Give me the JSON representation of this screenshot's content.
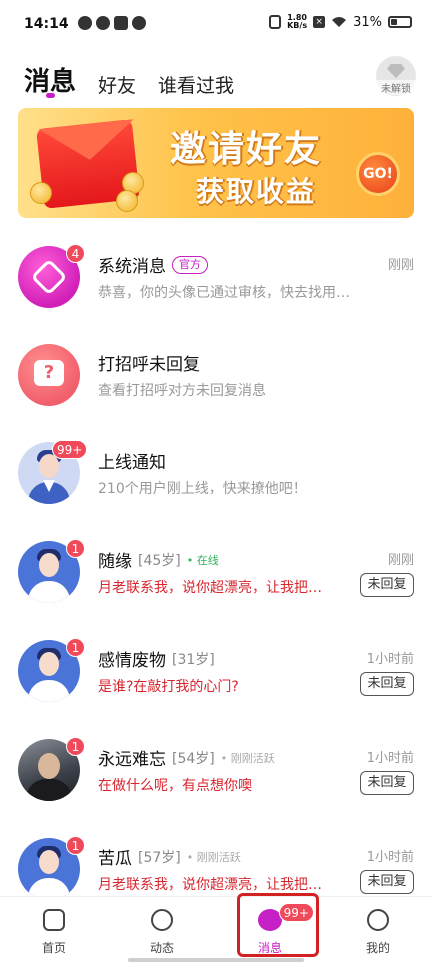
{
  "status_bar": {
    "time": "14:14",
    "net_speed_top": "1.80",
    "net_speed_bottom": "KB/s",
    "battery": "31%"
  },
  "header": {
    "tabs": [
      "消息",
      "好友",
      "谁看过我"
    ],
    "active_tab": "消息",
    "lock_label": "未解锁",
    "accent": "#c51fc6"
  },
  "banner": {
    "line1": "邀请好友",
    "line2": "获取收益",
    "go": "GO!"
  },
  "conversations": [
    {
      "title": "系统消息",
      "tag": "官方",
      "time": "刚刚",
      "preview": "恭喜，你的头像已通过审核，快去找用…",
      "badge": "4"
    },
    {
      "title": "打招呼未回复",
      "preview": "查看打招呼对方未回复消息"
    },
    {
      "title": "上线通知",
      "preview": "210个用户刚上线，快来撩他吧！",
      "badge": "99+"
    },
    {
      "title": "随缘",
      "age": "[45岁]",
      "presence": "在线",
      "time": "刚刚",
      "preview": "月老联系我，说你超漂亮，让我把…",
      "badge": "1",
      "action": "未回复"
    },
    {
      "title": "感情废物",
      "age": "[31岁]",
      "time": "1小时前",
      "preview": "是谁?在敲打我的心门?",
      "badge": "1",
      "action": "未回复"
    },
    {
      "title": "永远难忘",
      "age": "[54岁]",
      "presence": "刚刚活跃",
      "time": "1小时前",
      "preview": "在做什么呢，有点想你噢",
      "badge": "1",
      "action": "未回复"
    },
    {
      "title": "苦瓜",
      "age": "[57岁]",
      "presence": "刚刚活跃",
      "time": "1小时前",
      "preview": "月老联系我，说你超漂亮，让我把…",
      "badge": "1",
      "action": "未回复"
    }
  ],
  "bottom_nav": {
    "items": [
      "首页",
      "动态",
      "消息",
      "我的"
    ],
    "active": "消息",
    "message_badge": "99+"
  }
}
